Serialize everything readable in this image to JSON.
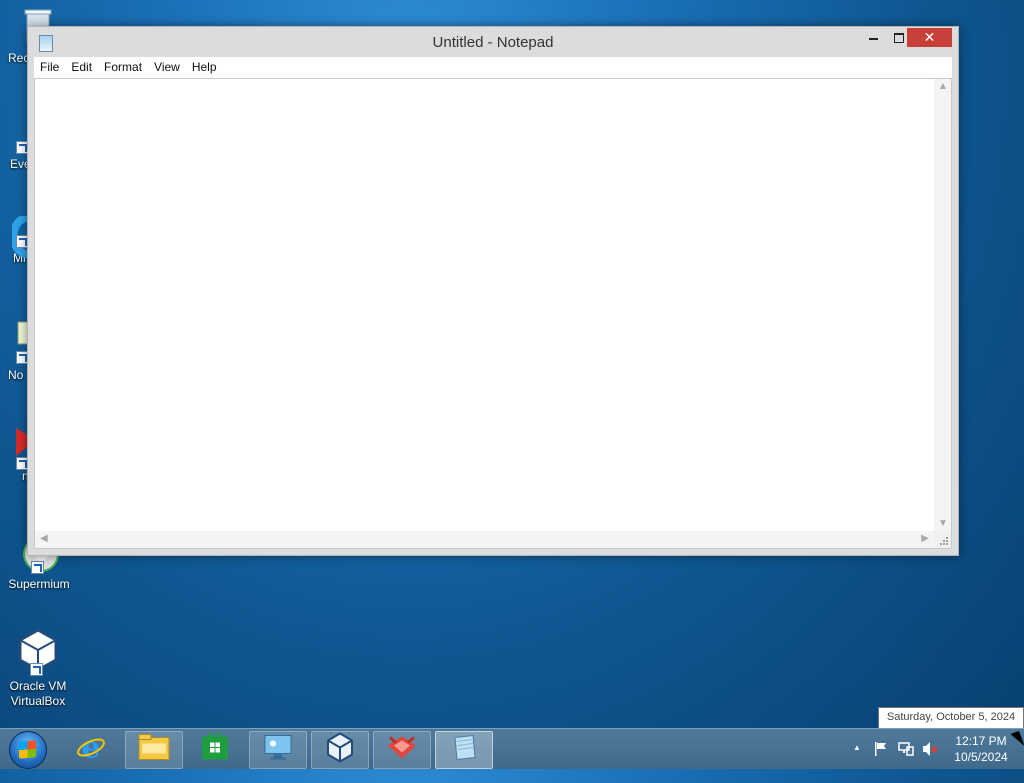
{
  "desktop": {
    "icons": [
      {
        "label": "Rec",
        "icon": "recycle-bin-icon"
      },
      {
        "label": "Eve",
        "icon": "shortcut-app-icon"
      },
      {
        "label": "Mi",
        "icon": "edge-browser-icon"
      },
      {
        "label": "No",
        "icon": "notepad-icon"
      },
      {
        "label": "n",
        "icon": "red-app-icon"
      },
      {
        "label": "Supermium",
        "icon": "supermium-browser-icon"
      },
      {
        "label": "Oracle VM VirtualBox",
        "icon": "virtualbox-icon"
      }
    ]
  },
  "window": {
    "title": "Untitled - Notepad",
    "close_symbol": "✕",
    "menu": [
      "File",
      "Edit",
      "Format",
      "View",
      "Help"
    ],
    "content": ""
  },
  "taskbar": {
    "items": [
      {
        "icon": "start-button-icon"
      },
      {
        "icon": "internet-explorer-icon"
      },
      {
        "icon": "file-explorer-icon"
      },
      {
        "icon": "store-icon"
      },
      {
        "icon": "remote-desktop-icon"
      },
      {
        "icon": "virtualbox-icon"
      },
      {
        "icon": "app-icon"
      },
      {
        "icon": "notepad-icon",
        "active": true
      }
    ],
    "tray": {
      "chevron": "▲",
      "icons": [
        "flag-icon",
        "network-icon",
        "speaker-muted-icon"
      ]
    },
    "clock": {
      "time": "12:17 PM",
      "date": "10/5/2024"
    },
    "tooltip": "Saturday, October 5, 2024"
  },
  "colors": {
    "close_button": "#c8403a",
    "taskbar": "#446f91",
    "desktop": "#1a6fb5"
  }
}
